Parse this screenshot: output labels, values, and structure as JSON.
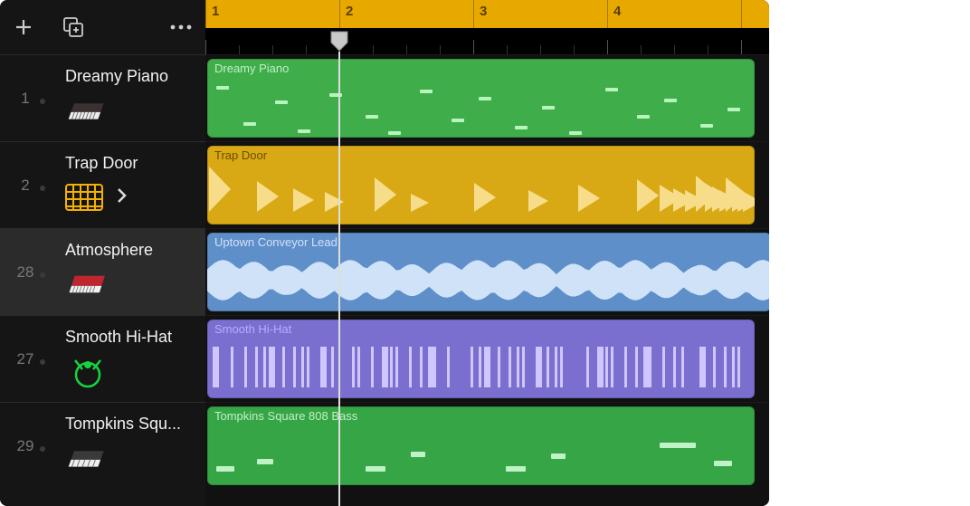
{
  "ruler": {
    "bars": [
      "1",
      "2",
      "3",
      "4"
    ]
  },
  "tracks": [
    {
      "num": "1",
      "name": "Dreamy Piano",
      "region_label": "Dreamy Piano",
      "color": "green"
    },
    {
      "num": "2",
      "name": "Trap Door",
      "region_label": "Trap Door",
      "color": "yellow"
    },
    {
      "num": "28",
      "name": "Atmosphere",
      "region_label": "Uptown Conveyor Lead",
      "color": "blue",
      "selected": true
    },
    {
      "num": "27",
      "name": "Smooth Hi-Hat",
      "region_label": "Smooth Hi-Hat",
      "color": "purple"
    },
    {
      "num": "29",
      "name": "Tompkins Squ...",
      "region_label": "Tompkins Square 808 Bass",
      "color": "green2"
    }
  ],
  "icons": {
    "add": "plus-icon",
    "duplicate": "duplicate-icon",
    "more": "more-icon"
  }
}
